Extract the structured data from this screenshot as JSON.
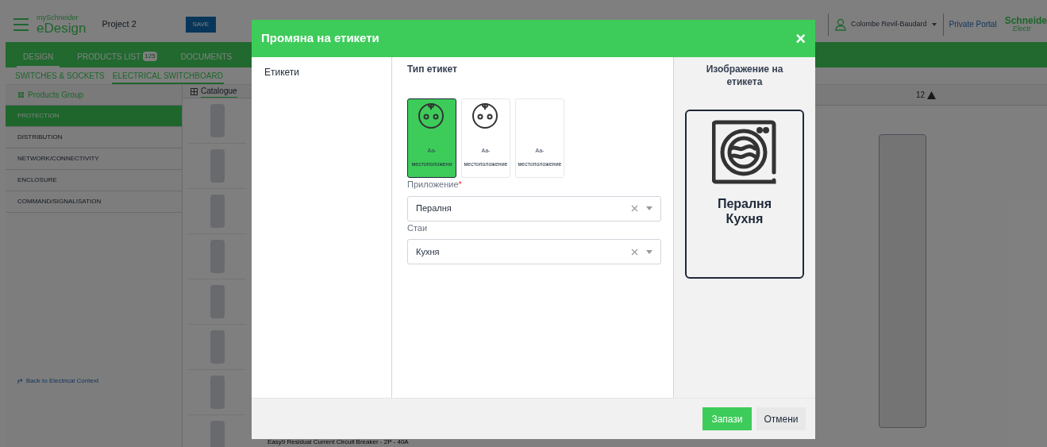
{
  "app_header": {
    "brand_top": "mySchneider",
    "brand": "eDesign",
    "project": "Project 2",
    "save_button": "SAVE",
    "user": "Colombe Revil-Baudard",
    "portal_link": "Private Portal",
    "logo_top": "Schneide",
    "logo_bottom": "Electr"
  },
  "main_tabs": [
    {
      "label": "DESIGN",
      "selected": true
    },
    {
      "label": "PRODUCTS LIST",
      "badge": "125",
      "selected": false
    },
    {
      "label": "DOCUMENTS",
      "selected": false
    }
  ],
  "sub_tabs": [
    {
      "label": "SWITCHES & SOCKETS",
      "selected": false
    },
    {
      "label": "ELECTRICAL SWITCHBOARD",
      "selected": true
    }
  ],
  "products_group": "Products Group",
  "categories": [
    {
      "label": "PROTECTION",
      "selected": true
    },
    {
      "label": "DISTRIBUTION",
      "selected": false
    },
    {
      "label": "NETWORK/CONNECTIVITY",
      "selected": false
    },
    {
      "label": "ENCLOSURE",
      "selected": false
    },
    {
      "label": "COMMAND/SIGNALISATION",
      "selected": false
    }
  ],
  "back_link": "Back to Electrical Context",
  "catalogue_tab": "Catalogue",
  "warnings_count": "12",
  "product_caption": "Easy9 Residual Current Circuit Breaker - 2P - 40A",
  "dialog": {
    "title": "Промяна на етикети",
    "close": "×",
    "section": "Етикети",
    "type_heading": "Тип етикет",
    "label_types": [
      {
        "kind": "socket",
        "line1": "Aa-",
        "line2": "местоположени",
        "selected": true
      },
      {
        "kind": "socket",
        "line1": "Aa-",
        "line2": "местоположение",
        "selected": false
      },
      {
        "kind": "blank",
        "line1": "Aa-",
        "line2": "местоположение",
        "selected": false
      }
    ],
    "fields": [
      {
        "label": "Приложение",
        "required_mark": "*",
        "value": "Пералня"
      },
      {
        "label": "Стаи",
        "value": "Кухня"
      }
    ],
    "preview": {
      "heading": "Изображение на етикета",
      "lines": [
        "Пералня",
        "Кухня"
      ]
    },
    "buttons": [
      {
        "label": "Запази",
        "kind": "primary"
      },
      {
        "label": "Отмени",
        "kind": "secondary"
      }
    ]
  }
}
